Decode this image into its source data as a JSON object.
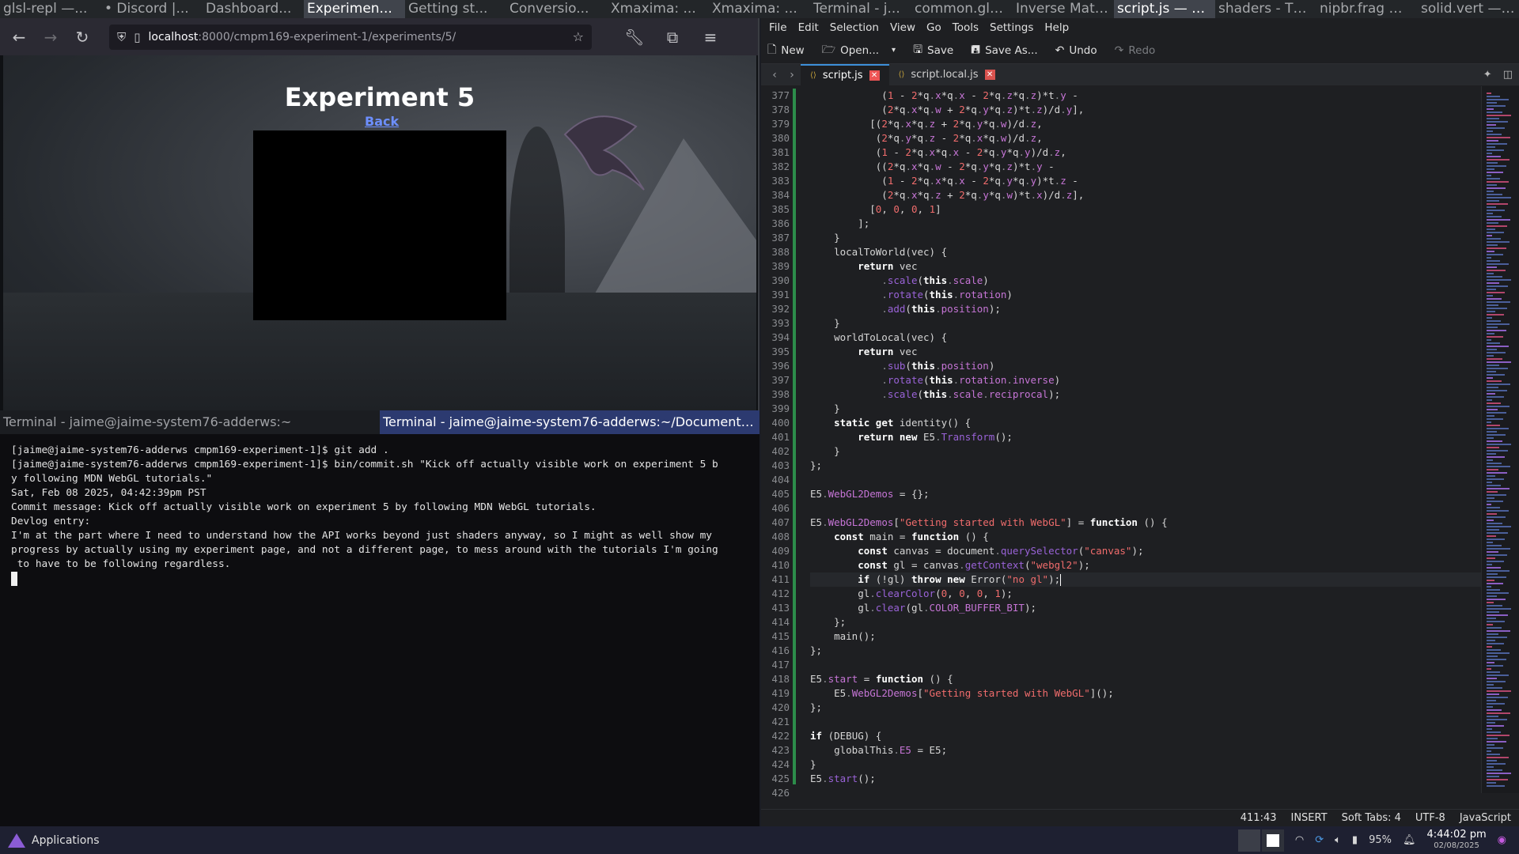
{
  "top_tabs": [
    {
      "label": "glsl-repl —..."
    },
    {
      "label": "• Discord |..."
    },
    {
      "label": "Dashboard..."
    },
    {
      "label": "Experimen...",
      "active": true
    },
    {
      "label": "Getting st..."
    },
    {
      "label": "Conversio..."
    },
    {
      "label": "Xmaxima: ..."
    },
    {
      "label": "Xmaxima: ..."
    },
    {
      "label": "Terminal - j..."
    },
    {
      "label": "common.glsl — ..."
    },
    {
      "label": "Inverse Matrix Ca..."
    },
    {
      "label": "script.js — KWrite",
      "active": true
    },
    {
      "label": "shaders - Thunar"
    },
    {
      "label": "nipbr.frag — KWr..."
    },
    {
      "label": "solid.vert — KWrite"
    }
  ],
  "browser": {
    "url_host": "localhost",
    "url_path": ":8000/cmpm169-experiment-1/experiments/5/",
    "page_title": "Experiment 5",
    "back_link": "Back"
  },
  "terminal": {
    "tabs": [
      {
        "label": "Terminal - jaime@jaime-system76-adderws:~"
      },
      {
        "label": "Terminal - jaime@jaime-system76-adderws:~/Documents...",
        "active": true
      }
    ],
    "lines": [
      "[jaime@jaime-system76-adderws cmpm169-experiment-1]$ git add .",
      "[jaime@jaime-system76-adderws cmpm169-experiment-1]$ bin/commit.sh \"Kick off actually visible work on experiment 5 b",
      "y following MDN WebGL tutorials.\"",
      "Sat, Feb 08 2025, 04:42:39pm PST",
      "Commit message: Kick off actually visible work on experiment 5 by following MDN WebGL tutorials.",
      "Devlog entry:",
      "I'm at the part where I need to understand how the API works beyond just shaders anyway, so I might as well show my",
      "progress by actually using my experiment page, and not a different page, to mess around with the tutorials I'm going",
      " to have to be following regardless."
    ]
  },
  "kwrite": {
    "menu": [
      "File",
      "Edit",
      "Selection",
      "View",
      "Go",
      "Tools",
      "Settings",
      "Help"
    ],
    "toolbar": {
      "new": "New",
      "open": "Open...",
      "save": "Save",
      "save_as": "Save As...",
      "undo": "Undo",
      "redo": "Redo"
    },
    "tabs": [
      {
        "label": "script.js",
        "active": true
      },
      {
        "label": "script.local.js"
      }
    ],
    "current_line": 411,
    "code_lines": [
      [
        377,
        "            (1 - 2*q.x*q.x - 2*q.z*q.z)*t.y -"
      ],
      [
        378,
        "            (2*q.x*q.w + 2*q.y*q.z)*t.z)/d.y],"
      ],
      [
        379,
        "          [(2*q.x*q.z + 2*q.y*q.w)/d.z,"
      ],
      [
        380,
        "           (2*q.y*q.z - 2*q.x*q.w)/d.z,"
      ],
      [
        381,
        "           (1 - 2*q.x*q.x - 2*q.y*q.y)/d.z,"
      ],
      [
        382,
        "           ((2*q.x*q.w - 2*q.y*q.z)*t.y -"
      ],
      [
        383,
        "            (1 - 2*q.x*q.x - 2*q.y*q.y)*t.z -"
      ],
      [
        384,
        "            (2*q.x*q.z + 2*q.y*q.w)*t.x)/d.z],"
      ],
      [
        385,
        "          [0, 0, 0, 1]"
      ],
      [
        386,
        "        ];"
      ],
      [
        387,
        "    }"
      ],
      [
        388,
        "    localToWorld(vec) {"
      ],
      [
        389,
        "        return vec"
      ],
      [
        390,
        "            .scale(this.scale)"
      ],
      [
        391,
        "            .rotate(this.rotation)"
      ],
      [
        392,
        "            .add(this.position);"
      ],
      [
        393,
        "    }"
      ],
      [
        394,
        "    worldToLocal(vec) {"
      ],
      [
        395,
        "        return vec"
      ],
      [
        396,
        "            .sub(this.position)"
      ],
      [
        397,
        "            .rotate(this.rotation.inverse)"
      ],
      [
        398,
        "            .scale(this.scale.reciprocal);"
      ],
      [
        399,
        "    }"
      ],
      [
        400,
        "    static get identity() {"
      ],
      [
        401,
        "        return new E5.Transform();"
      ],
      [
        402,
        "    }"
      ],
      [
        403,
        "};"
      ],
      [
        404,
        ""
      ],
      [
        405,
        "E5.WebGL2Demos = {};"
      ],
      [
        406,
        ""
      ],
      [
        407,
        "E5.WebGL2Demos[\"Getting started with WebGL\"] = function () {"
      ],
      [
        408,
        "    const main = function () {"
      ],
      [
        409,
        "        const canvas = document.querySelector(\"canvas\");"
      ],
      [
        410,
        "        const gl = canvas.getContext(\"webgl2\");"
      ],
      [
        411,
        "        if (!gl) throw new Error(\"no gl\");"
      ],
      [
        412,
        "        gl.clearColor(0, 0, 0, 1);"
      ],
      [
        413,
        "        gl.clear(gl.COLOR_BUFFER_BIT);"
      ],
      [
        414,
        "    };"
      ],
      [
        415,
        "    main();"
      ],
      [
        416,
        "};"
      ],
      [
        417,
        ""
      ],
      [
        418,
        "E5.start = function () {"
      ],
      [
        419,
        "    E5.WebGL2Demos[\"Getting started with WebGL\"]();"
      ],
      [
        420,
        "};"
      ],
      [
        421,
        ""
      ],
      [
        422,
        "if (DEBUG) {"
      ],
      [
        423,
        "    globalThis.E5 = E5;"
      ],
      [
        424,
        "}"
      ],
      [
        425,
        "E5.start();"
      ],
      [
        426,
        ""
      ]
    ],
    "status": {
      "position": "411:43",
      "mode": "INSERT",
      "indent": "Soft Tabs: 4",
      "encoding": "UTF-8",
      "language": "JavaScript"
    }
  },
  "taskbar": {
    "apps_label": "Applications",
    "battery": "95%",
    "time": "4:44:02 pm",
    "date": "02/08/2025"
  },
  "colors": {
    "accent": "#3d8fd9",
    "keyword": "#ffffff",
    "property": "#c675d6",
    "string": "#f06c6c",
    "terminal_active_tab": "#2c3a70"
  }
}
